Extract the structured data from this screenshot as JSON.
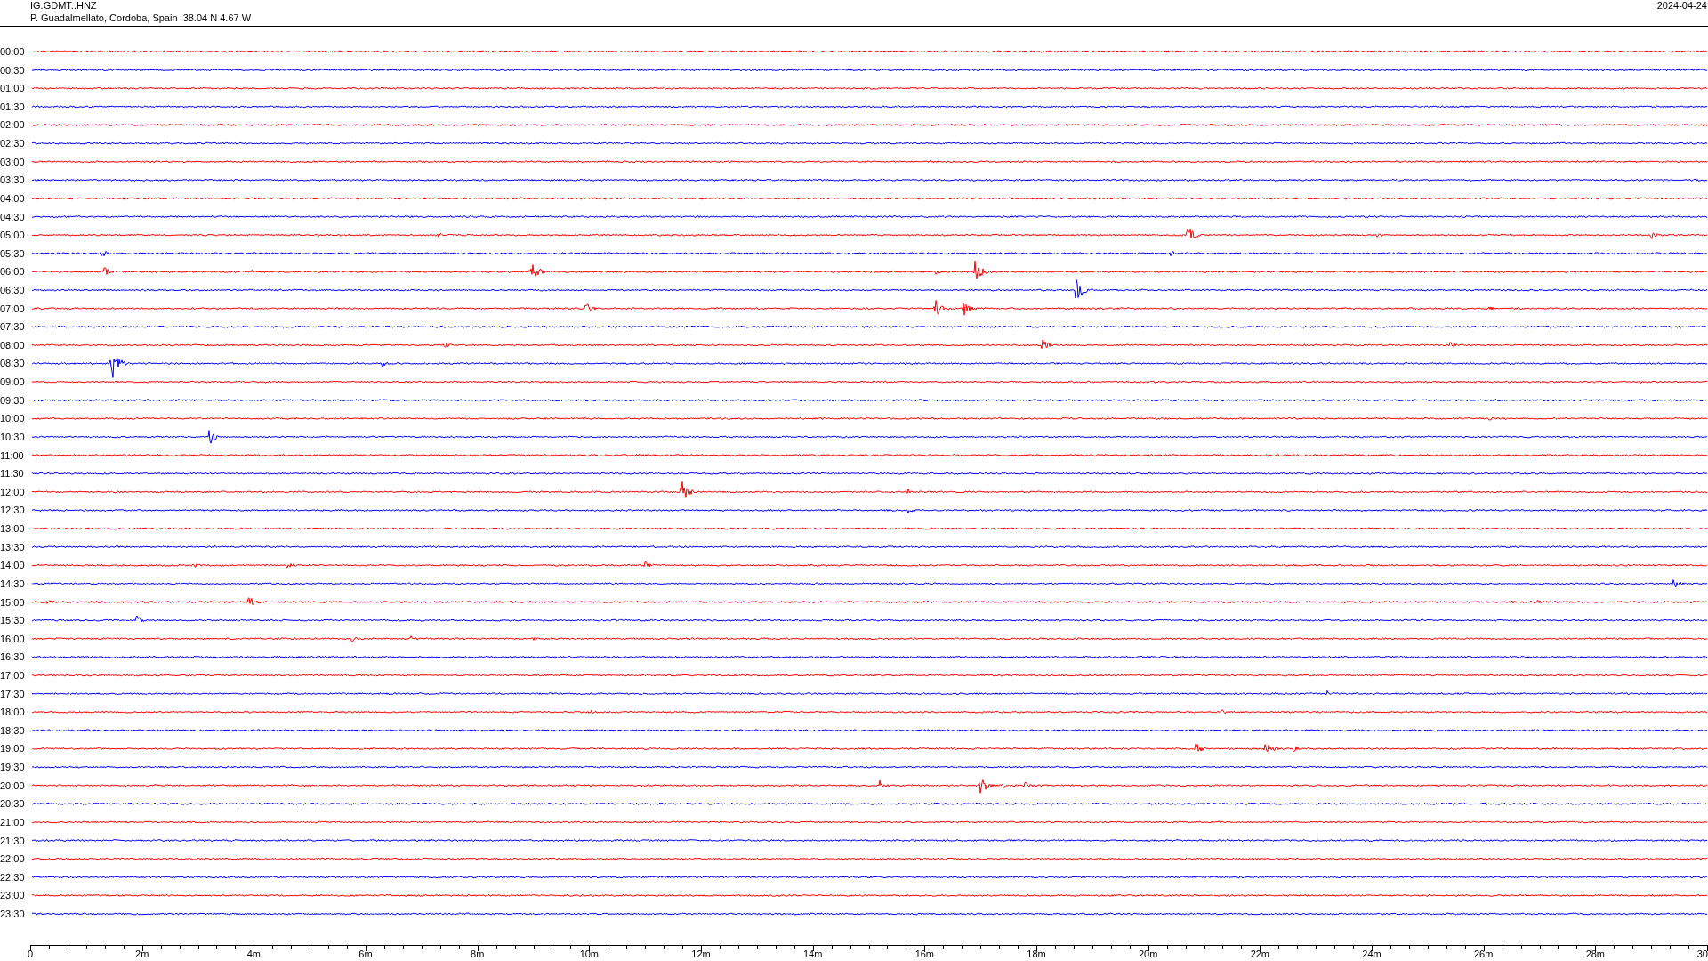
{
  "header": {
    "station": "IG.GDMT..HNZ",
    "location": "P. Guadalmellato, Cordoba, Spain  38.04 N 4.67 W",
    "date": "2024-04-24"
  },
  "rows": [
    {
      "time": "00:00",
      "color": "#ff0000"
    },
    {
      "time": "00:30",
      "color": "#0000ff"
    },
    {
      "time": "01:00",
      "color": "#ff0000"
    },
    {
      "time": "01:30",
      "color": "#0000ff"
    },
    {
      "time": "02:00",
      "color": "#ff0000"
    },
    {
      "time": "02:30",
      "color": "#0000ff"
    },
    {
      "time": "03:00",
      "color": "#ff0000"
    },
    {
      "time": "03:30",
      "color": "#0000ff"
    },
    {
      "time": "04:00",
      "color": "#ff0000"
    },
    {
      "time": "04:30",
      "color": "#0000ff"
    },
    {
      "time": "05:00",
      "color": "#ff0000"
    },
    {
      "time": "05:30",
      "color": "#0000ff"
    },
    {
      "time": "06:00",
      "color": "#ff0000"
    },
    {
      "time": "06:30",
      "color": "#0000ff"
    },
    {
      "time": "07:00",
      "color": "#ff0000"
    },
    {
      "time": "07:30",
      "color": "#0000ff"
    },
    {
      "time": "08:00",
      "color": "#ff0000"
    },
    {
      "time": "08:30",
      "color": "#0000ff"
    },
    {
      "time": "09:00",
      "color": "#ff0000"
    },
    {
      "time": "09:30",
      "color": "#0000ff"
    },
    {
      "time": "10:00",
      "color": "#ff0000"
    },
    {
      "time": "10:30",
      "color": "#0000ff"
    },
    {
      "time": "11:00",
      "color": "#ff0000"
    },
    {
      "time": "11:30",
      "color": "#0000ff"
    },
    {
      "time": "12:00",
      "color": "#ff0000"
    },
    {
      "time": "12:30",
      "color": "#0000ff"
    },
    {
      "time": "13:00",
      "color": "#ff0000"
    },
    {
      "time": "13:30",
      "color": "#0000ff"
    },
    {
      "time": "14:00",
      "color": "#ff0000"
    },
    {
      "time": "14:30",
      "color": "#0000ff"
    },
    {
      "time": "15:00",
      "color": "#ff0000"
    },
    {
      "time": "15:30",
      "color": "#0000ff"
    },
    {
      "time": "16:00",
      "color": "#ff0000"
    },
    {
      "time": "16:30",
      "color": "#0000ff"
    },
    {
      "time": "17:00",
      "color": "#ff0000"
    },
    {
      "time": "17:30",
      "color": "#0000ff"
    },
    {
      "time": "18:00",
      "color": "#ff0000"
    },
    {
      "time": "18:30",
      "color": "#0000ff"
    },
    {
      "time": "19:00",
      "color": "#ff0000"
    },
    {
      "time": "19:30",
      "color": "#0000ff"
    },
    {
      "time": "20:00",
      "color": "#ff0000"
    },
    {
      "time": "20:30",
      "color": "#0000ff"
    },
    {
      "time": "21:00",
      "color": "#ff0000"
    },
    {
      "time": "21:30",
      "color": "#0000ff"
    },
    {
      "time": "22:00",
      "color": "#ff0000"
    },
    {
      "time": "22:30",
      "color": "#0000ff"
    },
    {
      "time": "23:00",
      "color": "#ff0000"
    },
    {
      "time": "23:30",
      "color": "#0000ff"
    }
  ],
  "x_axis": {
    "ticks": [
      "0",
      "2m",
      "4m",
      "6m",
      "8m",
      "10m",
      "12m",
      "14m",
      "16m",
      "18m",
      "20m",
      "22m",
      "24m",
      "26m",
      "28m",
      "30"
    ]
  }
}
